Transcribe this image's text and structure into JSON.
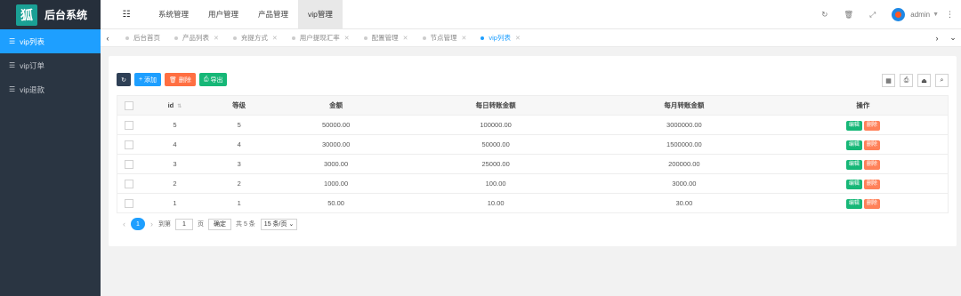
{
  "app": {
    "logo_char": "狐",
    "title": "后台系统"
  },
  "sidebar": {
    "items": [
      {
        "label": "vip列表",
        "active": true
      },
      {
        "label": "vip订单",
        "active": false
      },
      {
        "label": "vip退款",
        "active": false
      }
    ]
  },
  "header": {
    "nav": [
      {
        "label": "系统管理"
      },
      {
        "label": "用户管理"
      },
      {
        "label": "产品管理"
      },
      {
        "label": "vip管理",
        "active": true
      }
    ],
    "user": "admin"
  },
  "tabs": [
    {
      "label": "后台首页",
      "closable": false
    },
    {
      "label": "产品列表",
      "closable": true
    },
    {
      "label": "充提方式",
      "closable": true
    },
    {
      "label": "用户提现汇率",
      "closable": true
    },
    {
      "label": "配置管理",
      "closable": true
    },
    {
      "label": "节点管理",
      "closable": true
    },
    {
      "label": "vip列表",
      "closable": true,
      "active": true
    }
  ],
  "toolbar": {
    "add": "添加",
    "delete": "删除",
    "export": "导出"
  },
  "table": {
    "headers": [
      "id",
      "等级",
      "金额",
      "每日转账金额",
      "每月转账金额",
      "操作"
    ],
    "rows": [
      [
        "5",
        "5",
        "50000.00",
        "100000.00",
        "3000000.00"
      ],
      [
        "4",
        "4",
        "30000.00",
        "50000.00",
        "1500000.00"
      ],
      [
        "3",
        "3",
        "3000.00",
        "25000.00",
        "200000.00"
      ],
      [
        "2",
        "2",
        "1000.00",
        "100.00",
        "3000.00"
      ],
      [
        "1",
        "1",
        "50.00",
        "10.00",
        "30.00"
      ]
    ],
    "edit_label": "编辑",
    "delete_label": "删除"
  },
  "pager": {
    "current": "1",
    "goto_prefix": "到第",
    "goto_value": "1",
    "goto_suffix": "页",
    "confirm": "确定",
    "total": "共 5 条",
    "page_size": "15 条/页"
  },
  "colors": {
    "accent": "#1e9fff",
    "sidebar": "#2a3542",
    "success": "#16b777",
    "danger": "#ff5722"
  }
}
